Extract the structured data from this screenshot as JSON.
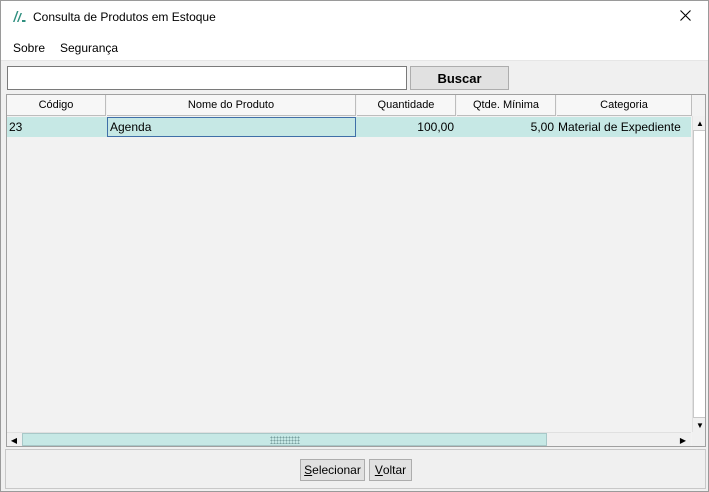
{
  "window": {
    "title": "Consulta de Produtos em Estoque",
    "accent": "#2f8f7f"
  },
  "menu": {
    "sobre_label": "Sobre",
    "seguranca_label": "Segurança"
  },
  "search": {
    "value": "",
    "placeholder": "",
    "button_label": "Buscar"
  },
  "grid": {
    "columns": [
      "Código",
      "Nome do Produto",
      "Quantidade",
      "Qtde. Mínima",
      "Categoria"
    ],
    "rows": [
      {
        "codigo": "23",
        "nome": "Agenda",
        "quantidade": "100,00",
        "qtde_minima": "5,00",
        "categoria": "Material de Expediente"
      }
    ],
    "selected_row_color": "#c6e8e5"
  },
  "actions": {
    "select_label": "Selecionar",
    "back_label": "Voltar"
  }
}
